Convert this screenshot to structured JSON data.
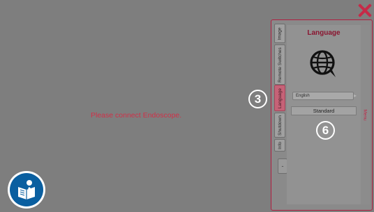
{
  "main": {
    "message": "Please connect Endoscope.",
    "message_color": "#d13048"
  },
  "side_panel": {
    "tabs": [
      {
        "label": "Image",
        "active": false
      },
      {
        "label": "Remote Switches",
        "active": false
      },
      {
        "label": "Language",
        "active": true
      },
      {
        "label": "Shutdown",
        "active": false
      },
      {
        "label": "Info",
        "active": false
      }
    ],
    "collapse_label": "-",
    "content": {
      "title": "Language",
      "icon": "globe-icon",
      "language_value": "English",
      "standard_button_label": "Standard"
    },
    "menu_label": "Menu"
  },
  "callouts": {
    "language_tab": "3",
    "standard_button": "6"
  },
  "colors": {
    "accent": "#b11e40",
    "manual_icon_bg": "#0a5fa0"
  }
}
